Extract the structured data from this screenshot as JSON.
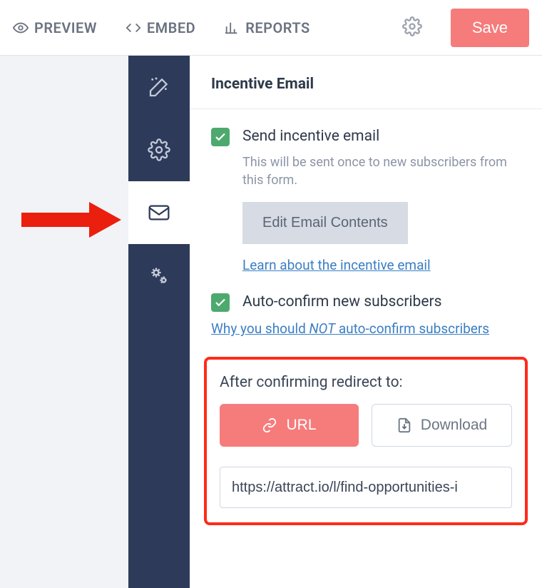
{
  "topbar": {
    "preview": "PREVIEW",
    "embed": "EMBED",
    "reports": "REPORTS",
    "save": "Save"
  },
  "header": {
    "title": "Incentive Email"
  },
  "incentive": {
    "checkbox_label": "Send incentive email",
    "description": "This will be sent once to new subscribers from this form.",
    "edit_button": "Edit Email Contents",
    "learn_link": "Learn about the incentive email"
  },
  "autoconfirm": {
    "checkbox_label": "Auto-confirm new subscribers",
    "link_prefix": "Why you should ",
    "link_em": "NOT",
    "link_suffix": " auto-confirm subscribers"
  },
  "redirect": {
    "title": "After confirming redirect to:",
    "url_btn": "URL",
    "download_btn": "Download",
    "url_value": "https://attract.io/l/find-opportunities-i"
  },
  "colors": {
    "accent_red": "#f67b7b",
    "highlight_red": "#ff2b1a",
    "nav_bg": "#2e3a59",
    "text_dark": "#2e3a4a",
    "link_blue": "#3b7fc4",
    "check_green": "#4ea96e"
  }
}
